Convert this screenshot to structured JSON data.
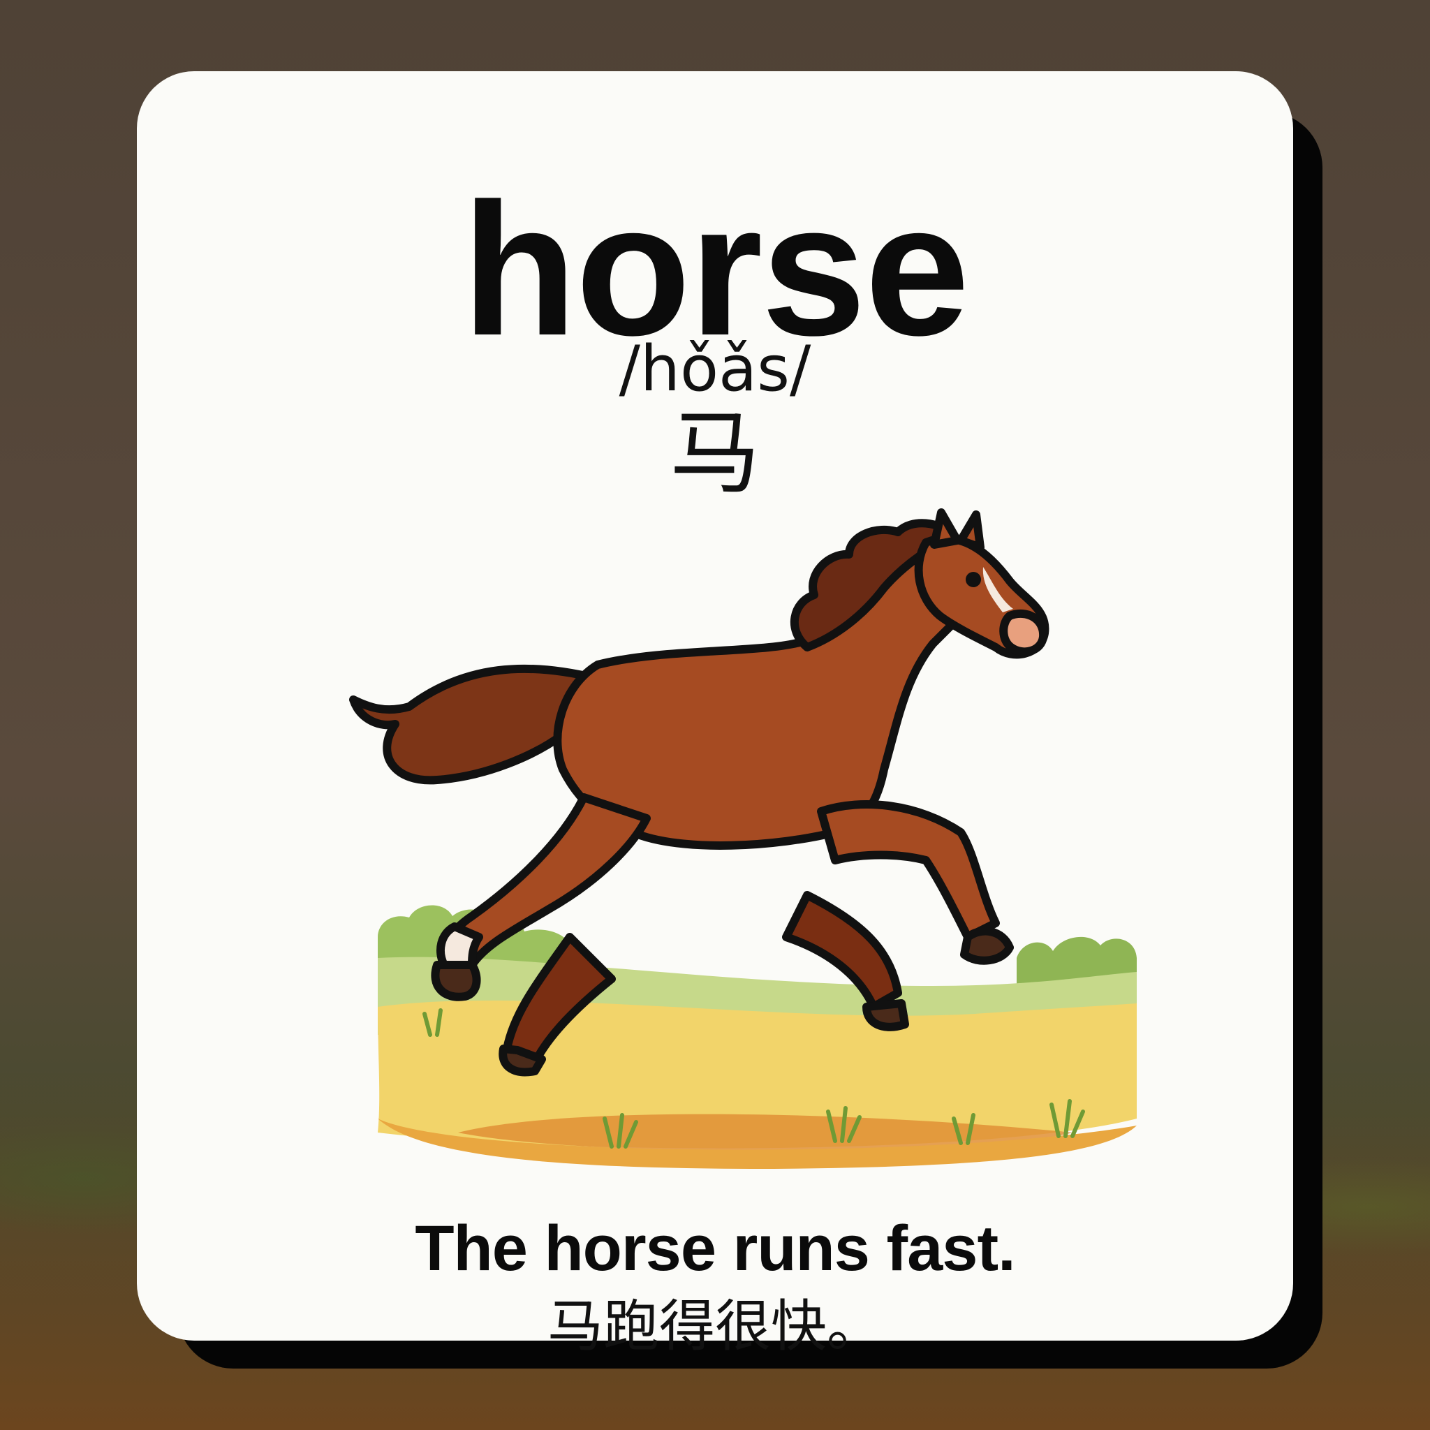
{
  "card": {
    "word": "horse",
    "pronunciation": "/hǒǎs/",
    "hanzi": "马",
    "sentence": "The horse runs fast.",
    "translation": "马跑得很快。"
  },
  "illustration": {
    "subject": "running-horse",
    "scene": "grassy-field",
    "colors": {
      "horse_body": "#a64b22",
      "horse_dark": "#6b2a12",
      "mane": "#6a2a14",
      "muzzle": "#e8a07e",
      "grass_green": "#9cc15e",
      "field_yellow": "#f2d46a",
      "dirt": "#d98a34",
      "outline": "#111111"
    }
  },
  "colors": {
    "card_background": "#fbfbf8",
    "page_background": "#4f4236",
    "text": "#0b0b0b"
  }
}
